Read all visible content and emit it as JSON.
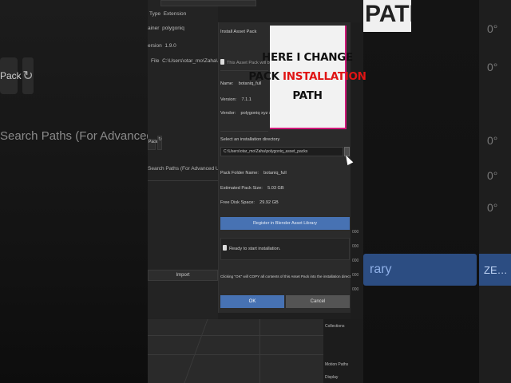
{
  "caption": {
    "line1": "HERE I CHANGE",
    "line2_prefix": "PACK ",
    "line2_highlight": "INSTALLATION",
    "line3": "PATH"
  },
  "background": {
    "pack_label": "Pack",
    "search_paths": "Search Paths (For Advanced Users)",
    "path_word": "PATH",
    "zeros": [
      "0°",
      "0°",
      "0°",
      "0°",
      "0°"
    ],
    "library_label": "rary",
    "right_label": "ZE…"
  },
  "extension_panel": {
    "type_label": "Type",
    "type_value": "Extension",
    "maintainer_label": "ainer",
    "maintainer_value": "polygoniq",
    "version_label": "ersion",
    "version_value": "1.9.0",
    "file_label": "File",
    "file_value": "C:\\Users\\otar_mo\\Zaha\\AppData\\Roaming\\Ble",
    "pack_label": "Pack",
    "search_paths": "Search Paths (For Advanced Users)",
    "import_label": "Import"
  },
  "dialog": {
    "title": "Install Asset Pack",
    "notice": "This Asset Pack will be installed:",
    "name_label": "Name:",
    "name_value": "botaniq_full",
    "version_label": "Version:",
    "version_value": "7.1.1",
    "vendor_label": "Vendor:",
    "vendor_value": "polygoniq xyz s.r.o.",
    "select_dir_label": "Select an installation directory",
    "install_path": "C:\\Users\\otar_mo\\Zaha\\polygoniq_asset_packs",
    "pack_folder_label": "Pack Folder Name:",
    "pack_folder_value": "botaniq_full",
    "est_size_label": "Estimated Pack Size:",
    "est_size_value": "5.03 GB",
    "free_space_label": "Free Disk Space:",
    "free_space_value": "29.92 GB",
    "register_label": "Register in Blender Asset Library",
    "ready_label": "Ready to start installation.",
    "copy_warning": "Clicking \"OK\" will COPY all contents of this Asset Pack into the installation directory.",
    "ok_label": "OK",
    "cancel_label": "Cancel"
  },
  "right_strip": {
    "values": [
      "000",
      "000",
      "000",
      "000",
      "000"
    ]
  },
  "outliner": {
    "collections": "Collections",
    "motion_paths": "Motion Paths",
    "display": "Display"
  },
  "colors": {
    "accent_blue": "#4772b3",
    "caption_red": "#e01414",
    "caption_border": "#d0187a"
  }
}
